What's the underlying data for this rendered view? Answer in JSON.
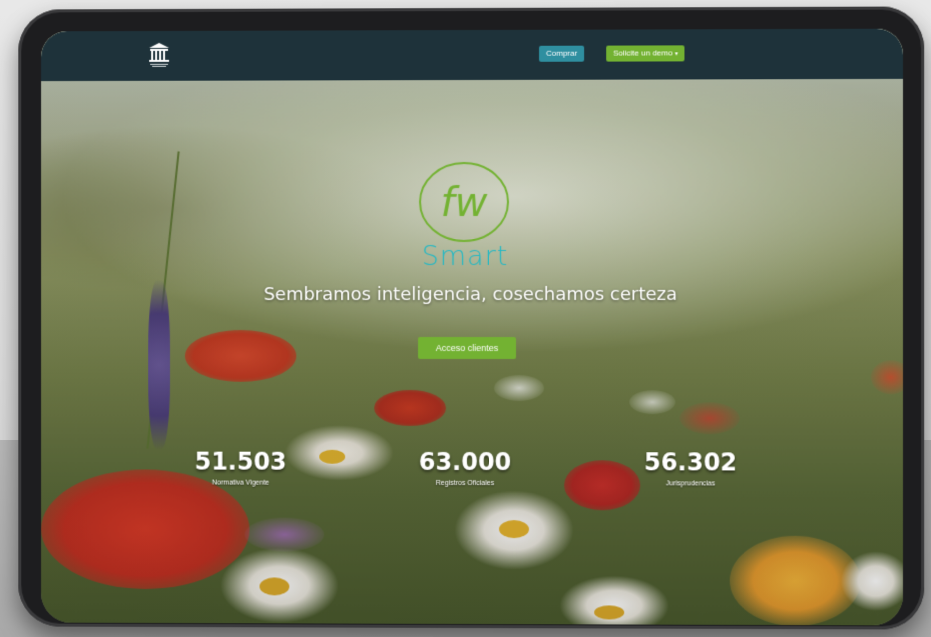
{
  "header": {
    "logo_icon": "institution-columns-icon",
    "comprar_label": "Comprar",
    "demo_label": "Solicite un demo"
  },
  "brand": {
    "monogram": "fw",
    "name": "Smart",
    "tagline": "Sembramos inteligencia, cosechamos certeza",
    "accent": "#22b8c4",
    "green": "#73b232"
  },
  "cta": {
    "acceso_label": "Acceso clientes"
  },
  "stats": [
    {
      "value": "51.503",
      "label": "Normativa Vigente"
    },
    {
      "value": "63.000",
      "label": "Registros Oficiales"
    },
    {
      "value": "56.302",
      "label": "Jurisprudencias"
    }
  ]
}
